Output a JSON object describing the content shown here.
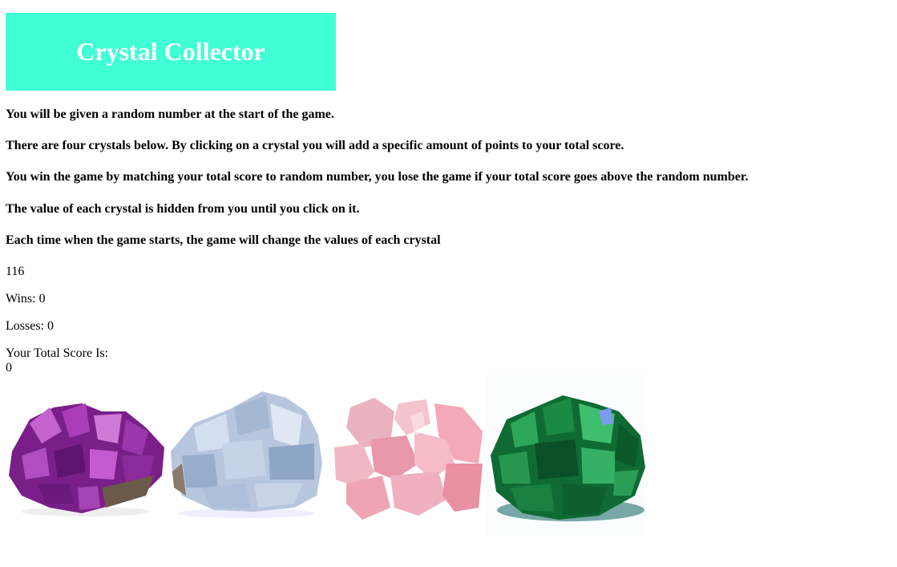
{
  "title": "Crystal Collector",
  "instructions": [
    "You will be given a random number at the start of the game.",
    "There are four crystals below. By clicking on a crystal you will add a specific amount of points to your total score.",
    "You win the game by matching your total score to random number, you lose the game if your total score goes above the random number.",
    "The value of each crystal is hidden from you until you click on it.",
    "Each time when the game starts, the game will change the values of each crystal"
  ],
  "random_number": "116",
  "wins_text": "Wins: 0",
  "losses_text": "Losses: 0",
  "score_label": "Your Total Score Is:",
  "score_value": "0",
  "crystals": [
    {
      "name": "amethyst",
      "color": "#8e2f9e"
    },
    {
      "name": "celestite",
      "color": "#a9bcd8"
    },
    {
      "name": "rose-quartz",
      "color": "#f0a9b8"
    },
    {
      "name": "emerald",
      "color": "#1c8a4a"
    }
  ],
  "colors": {
    "banner": "#40ffd5",
    "banner_text": "#ffffff"
  }
}
